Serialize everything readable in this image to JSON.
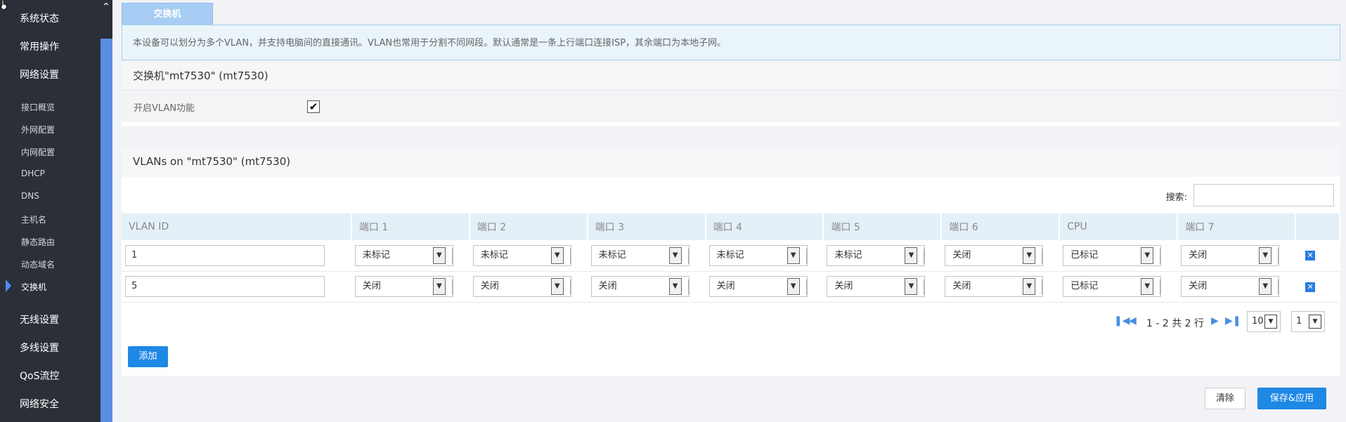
{
  "sidebar": {
    "top_items": [
      {
        "label": "系统状态"
      },
      {
        "label": "常用操作"
      },
      {
        "label": "网络设置"
      }
    ],
    "sub_items": [
      {
        "label": "接口概览"
      },
      {
        "label": "外网配置"
      },
      {
        "label": "内网配置"
      },
      {
        "label": "DHCP"
      },
      {
        "label": "DNS"
      },
      {
        "label": "主机名"
      },
      {
        "label": "静态路由"
      },
      {
        "label": "动态域名"
      },
      {
        "label": "交换机",
        "active": true
      }
    ],
    "bottom_items": [
      {
        "label": "无线设置"
      },
      {
        "label": "多线设置"
      },
      {
        "label": "QoS流控"
      },
      {
        "label": "网络安全"
      }
    ]
  },
  "tab": {
    "label": "交换机"
  },
  "description": "本设备可以划分为多个VLAN，并支持电脑间的直接通讯。VLAN也常用于分割不同网段。默认通常是一条上行端口连接ISP，其余端口为本地子网。",
  "switch_panel": {
    "title": "交换机\"mt7530\" (mt7530)",
    "enable_label": "开启VLAN功能",
    "enable_checked": true
  },
  "vlan_panel": {
    "title": "VLANs on \"mt7530\" (mt7530)",
    "search_label": "搜索:",
    "search_value": "",
    "columns": [
      "VLAN ID",
      "端口 1",
      "端口 2",
      "端口 3",
      "端口 4",
      "端口 5",
      "端口 6",
      "CPU",
      "端口 7"
    ],
    "rows": [
      {
        "vlan_id": "1",
        "ports": [
          "未标记",
          "未标记",
          "未标记",
          "未标记",
          "未标记",
          "关闭",
          "已标记",
          "关闭"
        ]
      },
      {
        "vlan_id": "5",
        "ports": [
          "关闭",
          "关闭",
          "关闭",
          "关闭",
          "关闭",
          "关闭",
          "已标记",
          "关闭"
        ]
      }
    ],
    "pagination": {
      "summary": "1 - 2 共 2 行",
      "page_size": "10",
      "page": "1"
    },
    "add_label": "添加"
  },
  "footer": {
    "reset_label": "清除",
    "save_label": "保存&应用"
  },
  "colors": {
    "sidebar_bg": "#2b2f38",
    "accent": "#1e88e5",
    "tab_bg": "#a7cdf5",
    "header_bg": "#e4f0f8"
  }
}
